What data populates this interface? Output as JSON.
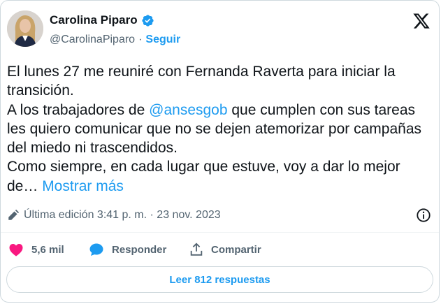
{
  "author": {
    "display_name": "Carolina Piparo",
    "handle": "@CarolinaPiparo",
    "separator": "·",
    "follow_label": "Seguir"
  },
  "tweet": {
    "line1": "El lunes 27 me reuniré con Fernanda Raverta para iniciar la transición.",
    "para2_before": "A los trabajadores de ",
    "mention": "@ansesgob",
    "para2_after": " que cumplen con sus tareas les quiero comunicar que no se dejen atemorizar por campañas del miedo ni trascendidos.",
    "para3": "Como siempre, en cada lugar que estuve, voy a dar lo mejor de…",
    "show_more": " Mostrar más"
  },
  "meta": {
    "edited": "Última edición 3:41 p. m. · 23 nov. 2023"
  },
  "actions": {
    "likes": "5,6 mil",
    "reply_label": "Responder",
    "share_label": "Compartir"
  },
  "read_replies_label": "Leer 812 respuestas",
  "colors": {
    "accent": "#1d9bf0",
    "like": "#f91880",
    "muted": "#536471",
    "text": "#0f1419"
  },
  "icons": [
    "verified-badge-icon",
    "x-logo-icon",
    "pencil-icon",
    "info-icon",
    "heart-icon",
    "speech-bubble-icon",
    "share-icon"
  ]
}
